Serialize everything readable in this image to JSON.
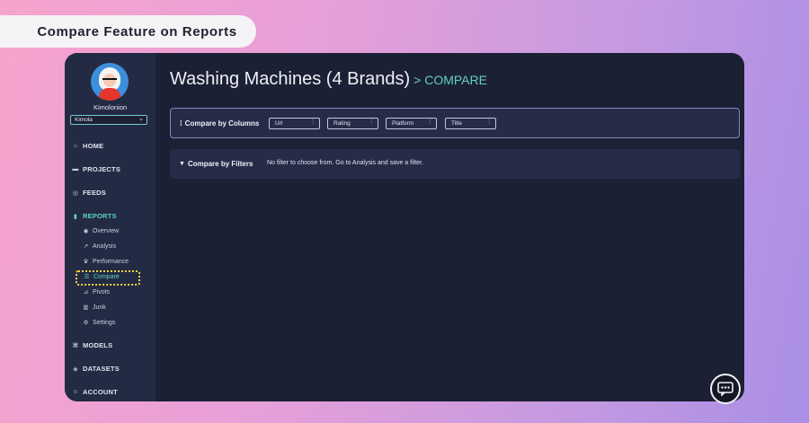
{
  "banner": {
    "text": "Compare Feature on Reports"
  },
  "sidebar": {
    "username": "Kimolonion",
    "select_value": "Kimola",
    "nav": {
      "home": "HOME",
      "projects": "PROJECTS",
      "feeds": "FEEDS",
      "reports": "REPORTS",
      "models": "MODELS",
      "datasets": "DATASETS",
      "account": "ACCOUNT"
    },
    "reports_sub": {
      "overview": "Overview",
      "analysis": "Analysis",
      "performance": "Performance",
      "compare": "Compare",
      "pivots": "Pivots",
      "junk": "Junk",
      "settings": "Settings"
    }
  },
  "main": {
    "title": "Washing Machines (4 Brands)",
    "title_suffix": "> COMPARE",
    "compare_columns_label": "Compare by Columns",
    "columns": [
      "Url",
      "Rating",
      "Platform",
      "Title"
    ],
    "compare_filters_label": "Compare by Filters",
    "no_filter_text": "No filter to choose from. Go to Analysis and save a filter."
  },
  "colors": {
    "accent": "#5fd3c1",
    "highlight": "#f2d83c",
    "window_bg": "#1c2034"
  }
}
